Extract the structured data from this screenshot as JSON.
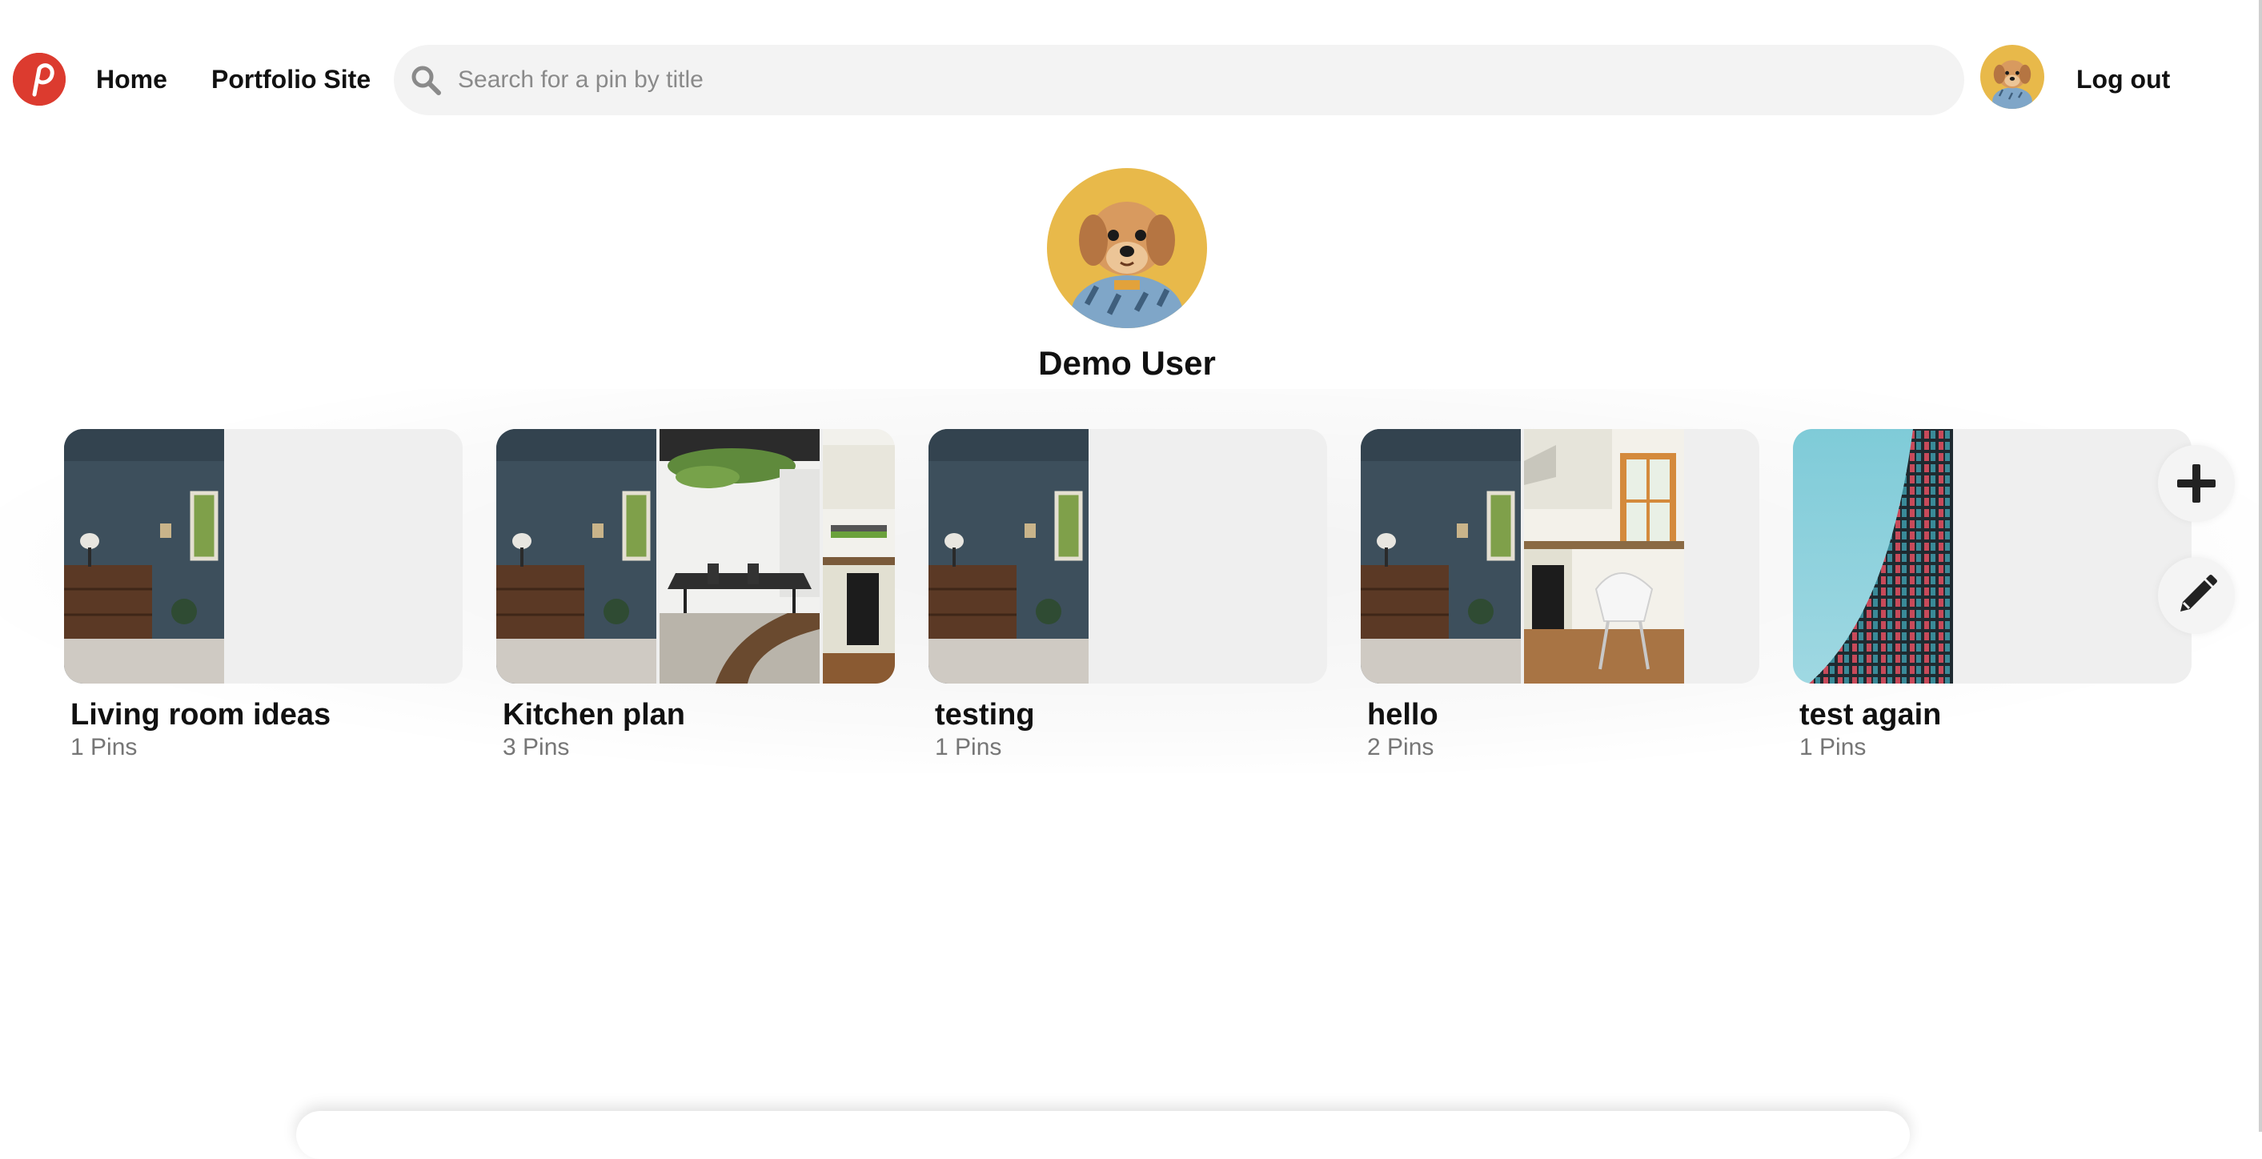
{
  "nav": {
    "home_label": "Home",
    "portfolio_label": "Portfolio Site",
    "logout_label": "Log out",
    "logo_icon": "pinterest-p-logo",
    "brand_color": "#dc3b2f"
  },
  "search": {
    "placeholder": "Search for a pin by title",
    "value": ""
  },
  "profile": {
    "name": "Demo User",
    "avatar": "dog-photo"
  },
  "boards": [
    {
      "title": "Living room ideas",
      "count": "1 Pins",
      "covers": [
        "living-room-photo"
      ]
    },
    {
      "title": "Kitchen plan",
      "count": "3 Pins",
      "covers": [
        "living-room-photo",
        "dining-room-photo",
        "kitchen-oven-photo"
      ]
    },
    {
      "title": "testing",
      "count": "1 Pins",
      "covers": [
        "living-room-photo"
      ]
    },
    {
      "title": "hello",
      "count": "2 Pins",
      "covers": [
        "living-room-photo",
        "kitchen-chair-photo"
      ]
    },
    {
      "title": "test again",
      "count": "1 Pins",
      "covers": [
        "building-facade-photo"
      ]
    }
  ],
  "actions": {
    "add_icon": "plus-icon",
    "edit_icon": "pencil-icon"
  }
}
